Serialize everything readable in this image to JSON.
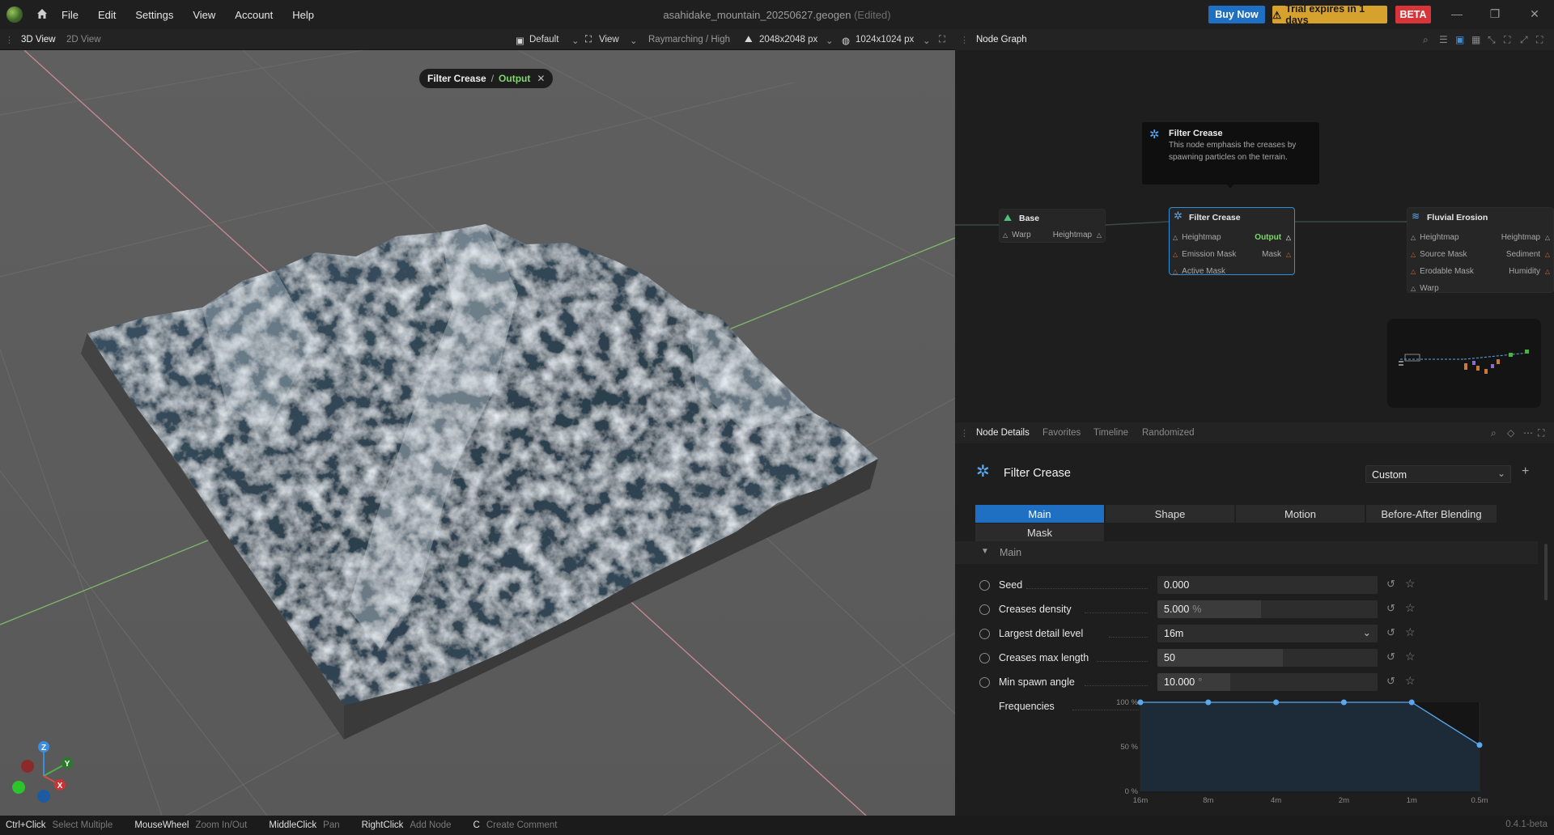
{
  "titlebar": {
    "menus": [
      "File",
      "Edit",
      "Settings",
      "View",
      "Account",
      "Help"
    ],
    "document": "asahidake_mountain_20250627.geogen",
    "edited": "(Edited)",
    "buy_now": "Buy Now",
    "trial": "Trial expires in 1 days",
    "beta": "BETA"
  },
  "viewport_toolbar": {
    "tabs": [
      "3D View",
      "2D View"
    ],
    "active_tab": "3D View",
    "camera": "Default",
    "view": "View",
    "render_mode": "Raymarching / High",
    "terrain_resolution": "2048x2048 px",
    "texture_resolution": "1024x1024 px"
  },
  "viewport": {
    "crumb_node": "Filter Crease",
    "crumb_sep": "/",
    "crumb_output": "Output",
    "axes": {
      "z": "Z",
      "y": "Y",
      "x": "X"
    }
  },
  "node_graph": {
    "title": "Node Graph",
    "tooltip": {
      "title": "Filter Crease",
      "text": "This node emphasis the creases by spawning particles on the terrain."
    },
    "nodes": {
      "base": {
        "title": "Base",
        "in": [
          "Warp"
        ],
        "out": [
          "Heightmap"
        ]
      },
      "filter_crease": {
        "title": "Filter Crease",
        "in": [
          "Heightmap",
          "Emission Mask",
          "Active Mask"
        ],
        "out": [
          "Output",
          "Mask"
        ]
      },
      "fluvial": {
        "title": "Fluvial Erosion",
        "in": [
          "Heightmap",
          "Source Mask",
          "Erodable Mask",
          "Warp"
        ],
        "out": [
          "Heightmap",
          "Sediment",
          "Humidity"
        ]
      }
    }
  },
  "node_details": {
    "tabs": [
      "Node Details",
      "Favorites",
      "Timeline",
      "Randomized"
    ],
    "active_tab": "Node Details",
    "node_name": "Filter Crease",
    "preset": "Custom",
    "param_tabs": [
      "Main",
      "Shape",
      "Motion",
      "Before-After Blending",
      "Mask"
    ],
    "active_param_tab": "Main",
    "section": "Main",
    "params": [
      {
        "label": "Seed",
        "value": "0.000",
        "unit": "",
        "fill": 0
      },
      {
        "label": "Creases density",
        "value": "5.000",
        "unit": "%",
        "fill": 0.47
      },
      {
        "label": "Largest detail level",
        "value": "16m",
        "unit": "",
        "fill": 0,
        "dropdown": true
      },
      {
        "label": "Creases max length",
        "value": "50",
        "unit": "",
        "fill": 0.57
      },
      {
        "label": "Min spawn angle",
        "value": "10.000",
        "unit": "°",
        "fill": 0.33
      }
    ],
    "frequencies": {
      "label": "Frequencies",
      "y_ticks": [
        "100 %",
        "50 %",
        "0 %"
      ],
      "x_ticks": [
        "16m",
        "8m",
        "4m",
        "2m",
        "1m",
        "0.5m"
      ],
      "values": [
        100,
        100,
        100,
        100,
        100,
        52
      ]
    }
  },
  "statusbar": {
    "hints": [
      {
        "key": "Ctrl+Click",
        "action": "Select Multiple"
      },
      {
        "key": "MouseWheel",
        "action": "Zoom In/Out"
      },
      {
        "key": "MiddleClick",
        "action": "Pan"
      },
      {
        "key": "RightClick",
        "action": "Add Node"
      },
      {
        "key": "C",
        "action": "Create Comment"
      }
    ],
    "version": "0.4.1-beta"
  },
  "colors": {
    "accent": "#1f6fc3",
    "trial": "#d7a12e",
    "beta": "#d8353a",
    "output": "#7fd96b",
    "selected_node": "#2f8fd8"
  }
}
